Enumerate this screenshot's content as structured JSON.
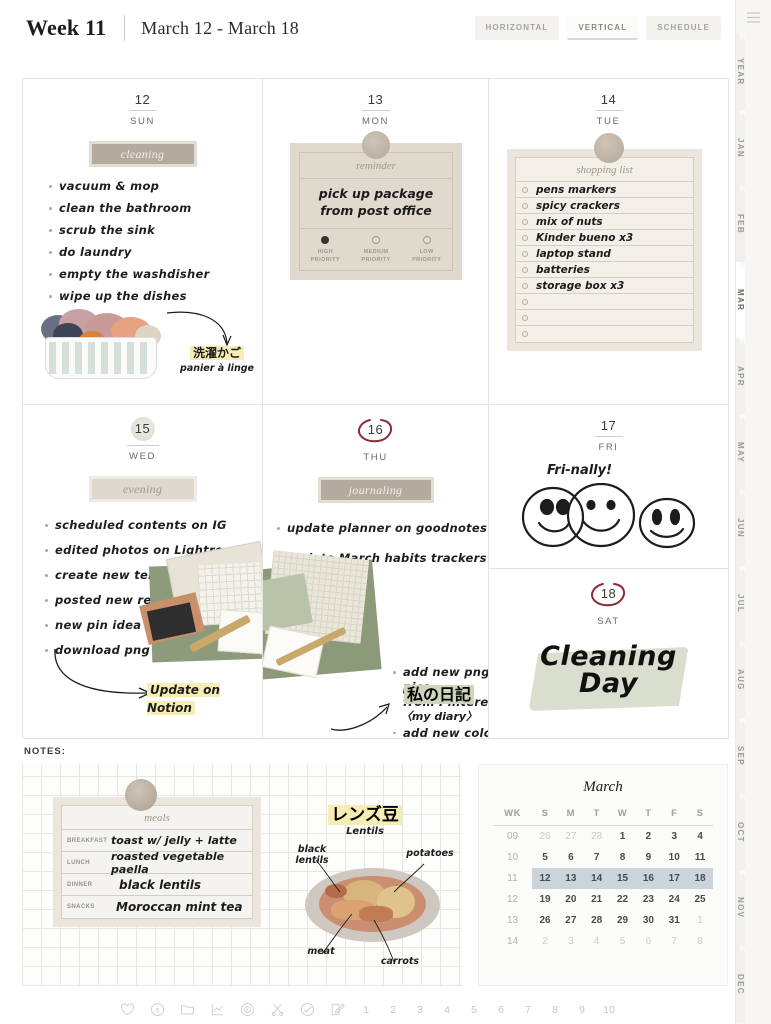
{
  "header": {
    "week_label": "Week 11",
    "date_range": "March 12 - March 18",
    "tabs": [
      {
        "label": "HORIZONTAL",
        "active": false
      },
      {
        "label": "VERTICAL",
        "active": true
      },
      {
        "label": "SCHEDULE",
        "active": false
      }
    ]
  },
  "days": {
    "sun": {
      "num": "12",
      "dow": "SUN",
      "pill": "cleaning",
      "tasks": [
        "vacuum & mop",
        "clean the bathroom",
        "scrub the sink",
        "do laundry",
        "empty the washdisher",
        "wipe up the dishes"
      ],
      "sticker_note_jp": "洗濯かご",
      "sticker_note_fr": "panier à linge"
    },
    "mon": {
      "num": "13",
      "dow": "MON",
      "reminder_title": "reminder",
      "reminder_body": "pick up package\nfrom post office",
      "priorities": [
        {
          "label": "HIGH\nPRIORITY",
          "selected": true
        },
        {
          "label": "MEDIUM\nPRIORITY",
          "selected": false
        },
        {
          "label": "LOW\nPRIORITY",
          "selected": false
        }
      ]
    },
    "tue": {
      "num": "14",
      "dow": "TUE",
      "list_title": "shopping list",
      "items": [
        "pens markers",
        "spicy crackers",
        "mix of nuts",
        "Kinder bueno x3",
        "laptop stand",
        "batteries",
        "storage box x3",
        "",
        "",
        ""
      ]
    },
    "wed": {
      "num": "15",
      "dow": "WED",
      "pill": "evening",
      "tasks": [
        "scheduled contents on IG",
        "edited photos on Lightroom",
        "create new template on Canva",
        "posted new reels IG",
        "new pin idea on Pinterest",
        "download png pics"
      ],
      "highlight_note": "Update on Notion"
    },
    "thu": {
      "num": "16",
      "dow": "THU",
      "pill": "journaling",
      "tasks": [
        "update planner on goodnotes",
        "update March habits trackers"
      ],
      "subtasks": [
        "add new png pics\nfrom Pinterest",
        "add new color\npalette"
      ],
      "note_jp": "私の日記",
      "note_en": "〈my diary〉"
    },
    "fri": {
      "num": "17",
      "dow": "FRI",
      "note": "Fri-nally!"
    },
    "sat": {
      "num": "18",
      "dow": "SAT",
      "title_line1": "Cleaning",
      "title_line2": "Day"
    }
  },
  "notes": {
    "label": "NOTES:",
    "meals": {
      "title": "meals",
      "rows": [
        {
          "key": "BREAKFAST",
          "value": "toast w/ jelly + latte"
        },
        {
          "key": "LUNCH",
          "value": "roasted vegetable paella"
        },
        {
          "key": "DINNER",
          "value": "black lentils"
        },
        {
          "key": "SNACKS",
          "value": "Moroccan mint tea"
        }
      ]
    },
    "lentils_sticker": {
      "title_jp": "レンズ豆",
      "title_en": "Lentils",
      "labels": [
        "black lentils",
        "potatoes",
        "meat",
        "carrots"
      ]
    }
  },
  "mini_calendar": {
    "title": "March",
    "headers": [
      "WK",
      "S",
      "M",
      "T",
      "W",
      "T",
      "F",
      "S"
    ],
    "rows": [
      {
        "wk": "09",
        "days": [
          "26",
          "27",
          "28",
          "1",
          "2",
          "3",
          "4"
        ],
        "muted": [
          true,
          true,
          true,
          false,
          false,
          false,
          false
        ],
        "current": false
      },
      {
        "wk": "10",
        "days": [
          "5",
          "6",
          "7",
          "8",
          "9",
          "10",
          "11"
        ],
        "muted": [
          false,
          false,
          false,
          false,
          false,
          false,
          false
        ],
        "current": false
      },
      {
        "wk": "11",
        "days": [
          "12",
          "13",
          "14",
          "15",
          "16",
          "17",
          "18"
        ],
        "muted": [
          false,
          false,
          false,
          false,
          false,
          false,
          false
        ],
        "current": true
      },
      {
        "wk": "12",
        "days": [
          "19",
          "20",
          "21",
          "22",
          "23",
          "24",
          "25"
        ],
        "muted": [
          false,
          false,
          false,
          false,
          false,
          false,
          false
        ],
        "current": false
      },
      {
        "wk": "13",
        "days": [
          "26",
          "27",
          "28",
          "29",
          "30",
          "31",
          "1"
        ],
        "muted": [
          false,
          false,
          false,
          false,
          false,
          false,
          true
        ],
        "current": false
      },
      {
        "wk": "14",
        "days": [
          "2",
          "3",
          "4",
          "5",
          "6",
          "7",
          "8"
        ],
        "muted": [
          true,
          true,
          true,
          true,
          true,
          true,
          true
        ],
        "current": false
      }
    ],
    "highlight_color": "#c9d5db"
  },
  "toolbar": {
    "icons": [
      "heart-icon",
      "dollar-icon",
      "folder-icon",
      "chart-icon",
      "target-icon",
      "scissors-icon",
      "check-icon",
      "edit-icon"
    ],
    "pages": [
      "1",
      "2",
      "3",
      "4",
      "5",
      "6",
      "7",
      "8",
      "9",
      "10"
    ]
  },
  "sidebar": {
    "menu_icon": "hamburger-icon",
    "tabs": [
      {
        "label": "YEAR",
        "active": false
      },
      {
        "label": "JAN",
        "active": false
      },
      {
        "label": "FEB",
        "active": false
      },
      {
        "label": "MAR",
        "active": true
      },
      {
        "label": "APR",
        "active": false
      },
      {
        "label": "MAY",
        "active": false
      },
      {
        "label": "JUN",
        "active": false
      },
      {
        "label": "JUL",
        "active": false
      },
      {
        "label": "AUG",
        "active": false
      },
      {
        "label": "SEP",
        "active": false
      },
      {
        "label": "OCT",
        "active": false
      },
      {
        "label": "NOV",
        "active": false
      },
      {
        "label": "DEC",
        "active": false
      }
    ]
  }
}
